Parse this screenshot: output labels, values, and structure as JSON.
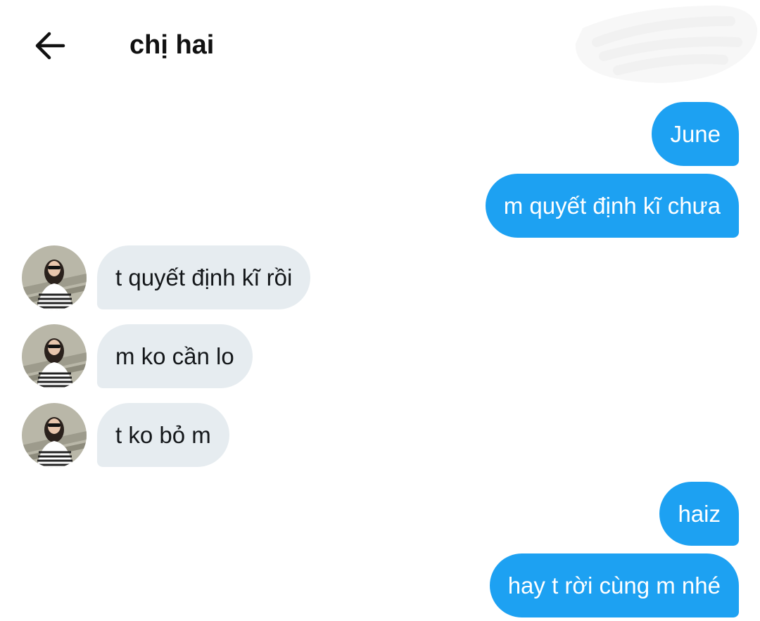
{
  "header": {
    "title": "chị hai",
    "back_icon": "arrow-left-icon"
  },
  "colors": {
    "outgoing_bubble": "#1da1f2",
    "incoming_bubble": "#e6ecf0",
    "outgoing_text": "#ffffff",
    "incoming_text": "#14171a"
  },
  "messages": [
    {
      "direction": "outgoing",
      "text": "June"
    },
    {
      "direction": "outgoing",
      "text": "m quyết định kĩ chưa"
    },
    {
      "direction": "incoming",
      "text": "t quyết định kĩ rồi"
    },
    {
      "direction": "incoming",
      "text": "m ko cần lo"
    },
    {
      "direction": "incoming",
      "text": "t ko bỏ m"
    },
    {
      "direction": "outgoing",
      "text": "haiz"
    },
    {
      "direction": "outgoing",
      "text": "hay t rời cùng m nhé"
    }
  ]
}
